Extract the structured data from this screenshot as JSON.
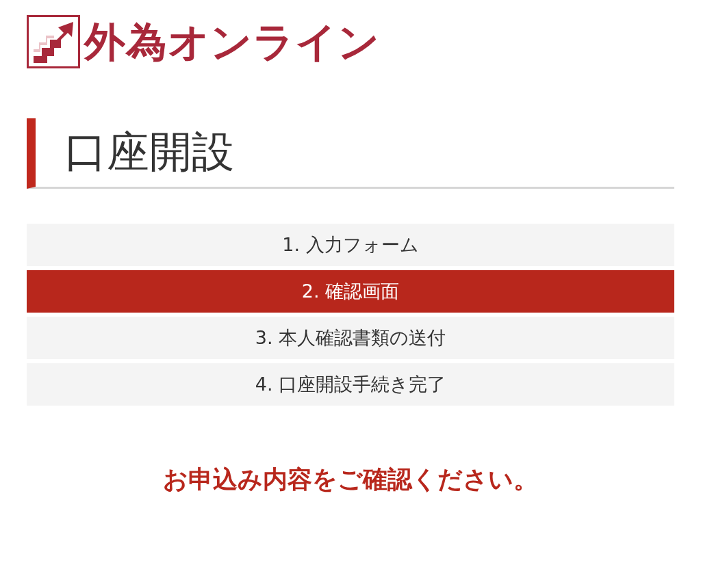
{
  "logo": {
    "text": "外為オンライン"
  },
  "heading": "口座開設",
  "steps": [
    {
      "label": "1. 入力フォーム",
      "selected": false
    },
    {
      "label": "2. 確認画面",
      "selected": true
    },
    {
      "label": "3. 本人確認書類の送付",
      "selected": false
    },
    {
      "label": "4. 口座開設手続き完了",
      "selected": false
    }
  ],
  "message": "お申込み内容をご確認ください。"
}
